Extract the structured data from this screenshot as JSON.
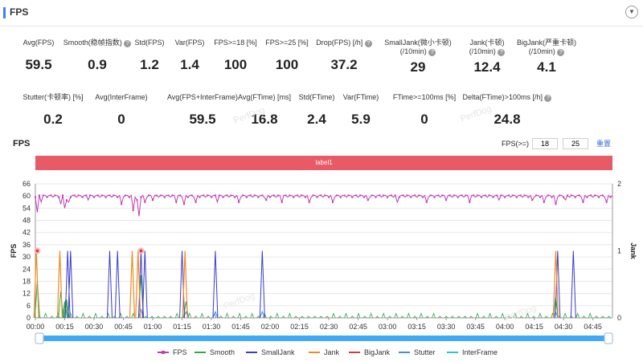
{
  "header": {
    "title": "FPS"
  },
  "stats_row1": [
    {
      "label": "Avg(FPS)",
      "value": "59.5",
      "info": false
    },
    {
      "label": "Smooth(稳帧指数)",
      "value": "0.9",
      "info": true
    },
    {
      "label": "Std(FPS)",
      "value": "1.2",
      "info": false
    },
    {
      "label": "Var(FPS)",
      "value": "1.4",
      "info": false
    },
    {
      "label": "FPS>=18 [%]",
      "value": "100",
      "info": false
    },
    {
      "label": "FPS>=25 [%]",
      "value": "100",
      "info": false
    },
    {
      "label": "Drop(FPS) [/h]",
      "value": "37.2",
      "info": true
    },
    {
      "label": "SmallJank(微小卡顿)",
      "label2": "(/10min)",
      "value": "29",
      "info": true
    },
    {
      "label": "Jank(卡顿)",
      "label2": "(/10min)",
      "value": "12.4",
      "info": true
    },
    {
      "label": "BigJank(严重卡顿)",
      "label2": "(/10min)",
      "value": "4.1",
      "info": true
    }
  ],
  "stats_row2": [
    {
      "label": "Stutter(卡顿率) [%]",
      "value": "0.2",
      "info": false
    },
    {
      "label": "Avg(InterFrame)",
      "value": "0",
      "info": false
    },
    {
      "label": "Avg(FPS+InterFrame)",
      "value": "59.5",
      "info": false
    },
    {
      "label": "Avg(FTime) [ms]",
      "value": "16.8",
      "info": false
    },
    {
      "label": "Std(FTime)",
      "value": "2.4",
      "info": false
    },
    {
      "label": "Var(FTime)",
      "value": "5.9",
      "info": false
    },
    {
      "label": "FTime>=100ms [%]",
      "value": "0",
      "info": false
    },
    {
      "label": "Delta(FTime)>100ms [/h]",
      "value": "24.8",
      "info": true
    }
  ],
  "watermark": "PerfDog",
  "chart_section": {
    "title": "FPS",
    "threshold_label": "FPS(>=)",
    "threshold_1": "18",
    "threshold_2": "25",
    "reset_label": "重置",
    "label_band": "label1"
  },
  "chart_data": {
    "type": "line",
    "ylabel": "FPS",
    "y2label": "Jank",
    "ylim": [
      0,
      66
    ],
    "y2lim": [
      0,
      2
    ],
    "yticks": [
      "0",
      "6",
      "12",
      "18",
      "24",
      "30",
      "36",
      "42",
      "48",
      "54",
      "60",
      "66"
    ],
    "y2ticks": [
      "0",
      "1",
      "2"
    ],
    "xticks": [
      "00:00",
      "00:15",
      "00:30",
      "00:45",
      "01:00",
      "01:15",
      "01:30",
      "01:45",
      "02:00",
      "02:15",
      "02:30",
      "02:45",
      "03:00",
      "03:15",
      "03:30",
      "03:45",
      "04:00",
      "04:15",
      "04:30",
      "04:45"
    ],
    "grid": true,
    "x_unit_seconds": 15,
    "x_range_seconds": [
      0,
      295
    ],
    "fps_dips": [
      [
        1,
        52
      ],
      [
        3,
        57
      ],
      [
        13,
        56
      ],
      [
        15,
        54
      ],
      [
        16,
        58
      ],
      [
        17,
        57
      ],
      [
        27,
        58
      ],
      [
        44,
        56
      ],
      [
        50,
        53
      ],
      [
        52,
        58
      ],
      [
        53,
        50
      ],
      [
        56,
        57
      ],
      [
        60,
        58
      ],
      [
        72,
        57
      ],
      [
        76,
        56
      ],
      [
        82,
        57
      ],
      [
        93,
        57
      ],
      [
        104,
        57
      ],
      [
        118,
        58
      ],
      [
        126,
        57
      ],
      [
        140,
        57
      ],
      [
        152,
        57
      ],
      [
        170,
        58
      ],
      [
        185,
        57
      ],
      [
        200,
        57
      ],
      [
        210,
        58
      ],
      [
        222,
        57
      ],
      [
        237,
        58
      ],
      [
        254,
        58
      ],
      [
        260,
        57
      ],
      [
        266,
        56
      ],
      [
        271,
        58
      ],
      [
        280,
        57
      ],
      [
        292,
        57
      ]
    ],
    "smalljank": [
      [
        16.5,
        1
      ],
      [
        18,
        1
      ],
      [
        38,
        1
      ],
      [
        42,
        1
      ],
      [
        54,
        1
      ],
      [
        56,
        1
      ],
      [
        75,
        1
      ],
      [
        92,
        1
      ],
      [
        116,
        1
      ],
      [
        267,
        1
      ],
      [
        275,
        1
      ]
    ],
    "jank": [
      [
        0.5,
        1
      ],
      [
        12.5,
        1
      ],
      [
        49.5,
        1
      ],
      [
        52.5,
        1
      ],
      [
        76.5,
        1
      ],
      [
        266,
        1
      ]
    ],
    "bigjank": [
      [
        1,
        1
      ],
      [
        54,
        1
      ]
    ],
    "smooth": [
      [
        1,
        18
      ],
      [
        13,
        13
      ],
      [
        15,
        8
      ],
      [
        15.5,
        9
      ],
      [
        16,
        9
      ],
      [
        54,
        21
      ],
      [
        77,
        8
      ],
      [
        266,
        10
      ]
    ],
    "stutter": [
      [
        54,
        4
      ],
      [
        77,
        3
      ],
      [
        92,
        3
      ],
      [
        116,
        3
      ],
      [
        266,
        3
      ]
    ],
    "legend": [
      {
        "name": "FPS",
        "color": "#c23bb6"
      },
      {
        "name": "Smooth",
        "color": "#2ba84a"
      },
      {
        "name": "SmallJank",
        "color": "#3a3ad0"
      },
      {
        "name": "Jank",
        "color": "#f08a24"
      },
      {
        "name": "BigJank",
        "color": "#d63b3b"
      },
      {
        "name": "Stutter",
        "color": "#3f8fe0"
      },
      {
        "name": "InterFrame",
        "color": "#26c6d6"
      }
    ],
    "slider": {
      "start_fraction": 0.0,
      "end_fraction": 1.0,
      "color": "#3fa9f5"
    }
  }
}
